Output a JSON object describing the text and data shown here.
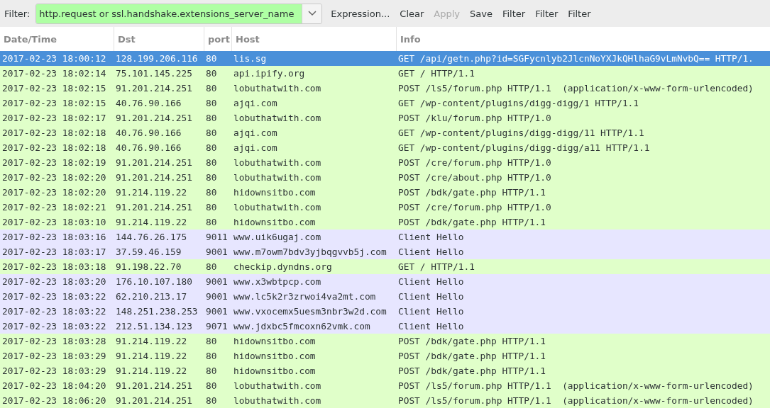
{
  "toolbar": {
    "filter_label": "Filter:",
    "filter_value": "http.request or ssl.handshake.extensions_server_name",
    "buttons": [
      {
        "label": "Expression...",
        "disabled": false
      },
      {
        "label": "Clear",
        "disabled": false
      },
      {
        "label": "Apply",
        "disabled": true
      },
      {
        "label": "Save",
        "disabled": false
      },
      {
        "label": "Filter",
        "disabled": false
      },
      {
        "label": "Filter",
        "disabled": false
      },
      {
        "label": "Filter",
        "disabled": false
      }
    ]
  },
  "table": {
    "columns": [
      "Date/Time",
      "Dst",
      "port",
      "Host",
      "Info"
    ],
    "rows": [
      {
        "kind": "http",
        "selected": true,
        "cells": [
          "2017-02-23 18:00:12",
          "128.199.206.116",
          "80",
          "lis.sg",
          "GET /api/getn.php?id=SGFycnlyb2JlcnNoYXJkQHlhaG9vLmNvbQ== HTTP/1."
        ]
      },
      {
        "kind": "http",
        "selected": false,
        "cells": [
          "2017-02-23 18:02:14",
          "75.101.145.225",
          "80",
          "api.ipify.org",
          "GET / HTTP/1.1"
        ]
      },
      {
        "kind": "http",
        "selected": false,
        "cells": [
          "2017-02-23 18:02:15",
          "91.201.214.251",
          "80",
          "lobuthatwith.com",
          "POST /ls5/forum.php HTTP/1.1  (application/x-www-form-urlencoded)"
        ]
      },
      {
        "kind": "http",
        "selected": false,
        "cells": [
          "2017-02-23 18:02:15",
          "40.76.90.166",
          "80",
          "ajqi.com",
          "GET /wp-content/plugins/digg-digg/1 HTTP/1.1"
        ]
      },
      {
        "kind": "http",
        "selected": false,
        "cells": [
          "2017-02-23 18:02:17",
          "91.201.214.251",
          "80",
          "lobuthatwith.com",
          "POST /klu/forum.php HTTP/1.0"
        ]
      },
      {
        "kind": "http",
        "selected": false,
        "cells": [
          "2017-02-23 18:02:18",
          "40.76.90.166",
          "80",
          "ajqi.com",
          "GET /wp-content/plugins/digg-digg/11 HTTP/1.1"
        ]
      },
      {
        "kind": "http",
        "selected": false,
        "cells": [
          "2017-02-23 18:02:18",
          "40.76.90.166",
          "80",
          "ajqi.com",
          "GET /wp-content/plugins/digg-digg/a11 HTTP/1.1"
        ]
      },
      {
        "kind": "http",
        "selected": false,
        "cells": [
          "2017-02-23 18:02:19",
          "91.201.214.251",
          "80",
          "lobuthatwith.com",
          "POST /cre/forum.php HTTP/1.0"
        ]
      },
      {
        "kind": "http",
        "selected": false,
        "cells": [
          "2017-02-23 18:02:20",
          "91.201.214.251",
          "80",
          "lobuthatwith.com",
          "POST /cre/about.php HTTP/1.0"
        ]
      },
      {
        "kind": "http",
        "selected": false,
        "cells": [
          "2017-02-23 18:02:20",
          "91.214.119.22",
          "80",
          "hidownsitbo.com",
          "POST /bdk/gate.php HTTP/1.1"
        ]
      },
      {
        "kind": "http",
        "selected": false,
        "cells": [
          "2017-02-23 18:02:21",
          "91.201.214.251",
          "80",
          "lobuthatwith.com",
          "POST /cre/forum.php HTTP/1.0"
        ]
      },
      {
        "kind": "http",
        "selected": false,
        "cells": [
          "2017-02-23 18:03:10",
          "91.214.119.22",
          "80",
          "hidownsitbo.com",
          "POST /bdk/gate.php HTTP/1.1"
        ]
      },
      {
        "kind": "tls",
        "selected": false,
        "cells": [
          "2017-02-23 18:03:16",
          "144.76.26.175",
          "9011",
          "www.uik6ugaj.com",
          "Client Hello"
        ]
      },
      {
        "kind": "tls",
        "selected": false,
        "cells": [
          "2017-02-23 18:03:17",
          "37.59.46.159",
          "9001",
          "www.m7owm7bdv3yjbqgvvb5j.com",
          "Client Hello"
        ]
      },
      {
        "kind": "http",
        "selected": false,
        "cells": [
          "2017-02-23 18:03:18",
          "91.198.22.70",
          "80",
          "checkip.dyndns.org",
          "GET / HTTP/1.1"
        ]
      },
      {
        "kind": "tls",
        "selected": false,
        "cells": [
          "2017-02-23 18:03:20",
          "176.10.107.180",
          "9001",
          "www.x3wbtpcp.com",
          "Client Hello"
        ]
      },
      {
        "kind": "tls",
        "selected": false,
        "cells": [
          "2017-02-23 18:03:22",
          "62.210.213.17",
          "9001",
          "www.lc5k2r3zrwoi4va2mt.com",
          "Client Hello"
        ]
      },
      {
        "kind": "tls",
        "selected": false,
        "cells": [
          "2017-02-23 18:03:22",
          "148.251.238.253",
          "9001",
          "www.vxocemx5uesm3nbr3w2d.com",
          "Client Hello"
        ]
      },
      {
        "kind": "tls",
        "selected": false,
        "cells": [
          "2017-02-23 18:03:22",
          "212.51.134.123",
          "9071",
          "www.jdxbc5fmcoxn62vmk.com",
          "Client Hello"
        ]
      },
      {
        "kind": "http",
        "selected": false,
        "cells": [
          "2017-02-23 18:03:28",
          "91.214.119.22",
          "80",
          "hidownsitbo.com",
          "POST /bdk/gate.php HTTP/1.1"
        ]
      },
      {
        "kind": "http",
        "selected": false,
        "cells": [
          "2017-02-23 18:03:29",
          "91.214.119.22",
          "80",
          "hidownsitbo.com",
          "POST /bdk/gate.php HTTP/1.1"
        ]
      },
      {
        "kind": "http",
        "selected": false,
        "cells": [
          "2017-02-23 18:03:29",
          "91.214.119.22",
          "80",
          "hidownsitbo.com",
          "POST /bdk/gate.php HTTP/1.1"
        ]
      },
      {
        "kind": "http",
        "selected": false,
        "cells": [
          "2017-02-23 18:04:20",
          "91.201.214.251",
          "80",
          "lobuthatwith.com",
          "POST /ls5/forum.php HTTP/1.1  (application/x-www-form-urlencoded)"
        ]
      },
      {
        "kind": "http",
        "selected": false,
        "cells": [
          "2017-02-23 18:06:20",
          "91.201.214.251",
          "80",
          "lobuthatwith.com",
          "POST /ls5/forum.php HTTP/1.1  (application/x-www-form-urlencoded)"
        ]
      }
    ]
  }
}
